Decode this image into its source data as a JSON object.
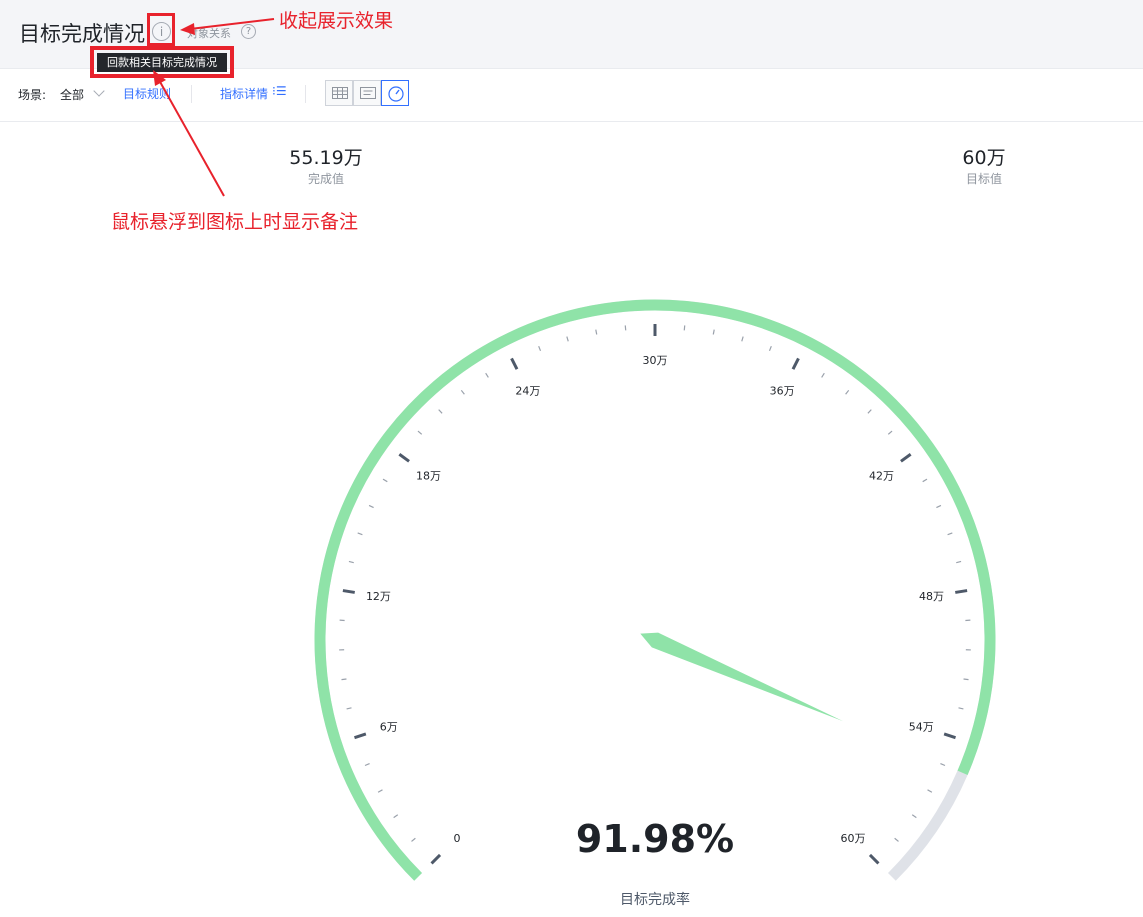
{
  "header": {
    "title": "目标完成情况",
    "info_icon": "info-icon",
    "subtitle": "对象关系",
    "help_icon": "help-icon",
    "tooltip": "回款相关目标完成情况"
  },
  "annotations": {
    "collapse": "收起展示效果",
    "hover": "鼠标悬浮到图标上时显示备注",
    "color": "#e8222c"
  },
  "toolbar": {
    "scene_label": "场景:",
    "scene_value": "全部",
    "rule_link": "目标规则",
    "detail_link": "指标详情",
    "views": [
      "table-view-icon",
      "card-view-icon",
      "gauge-view-icon"
    ],
    "active_view": "gauge-view-icon"
  },
  "stats": {
    "done_value": "55.19万",
    "done_caption": "完成值",
    "target_value": "60万",
    "target_caption": "目标值"
  },
  "chart_data": {
    "type": "gauge",
    "min": 0,
    "max": 60,
    "value": 55.19,
    "unit": "万",
    "tick_labels": [
      "0",
      "6万",
      "12万",
      "18万",
      "24万",
      "30万",
      "36万",
      "42万",
      "48万",
      "54万",
      "60万"
    ],
    "center_text": "91.98%",
    "caption": "目标完成率",
    "progress_color": "#8fe3a8",
    "track_color": "#dfe2e8",
    "pointer_color": "#8fe3a8",
    "tick_color": "#4e5969"
  }
}
